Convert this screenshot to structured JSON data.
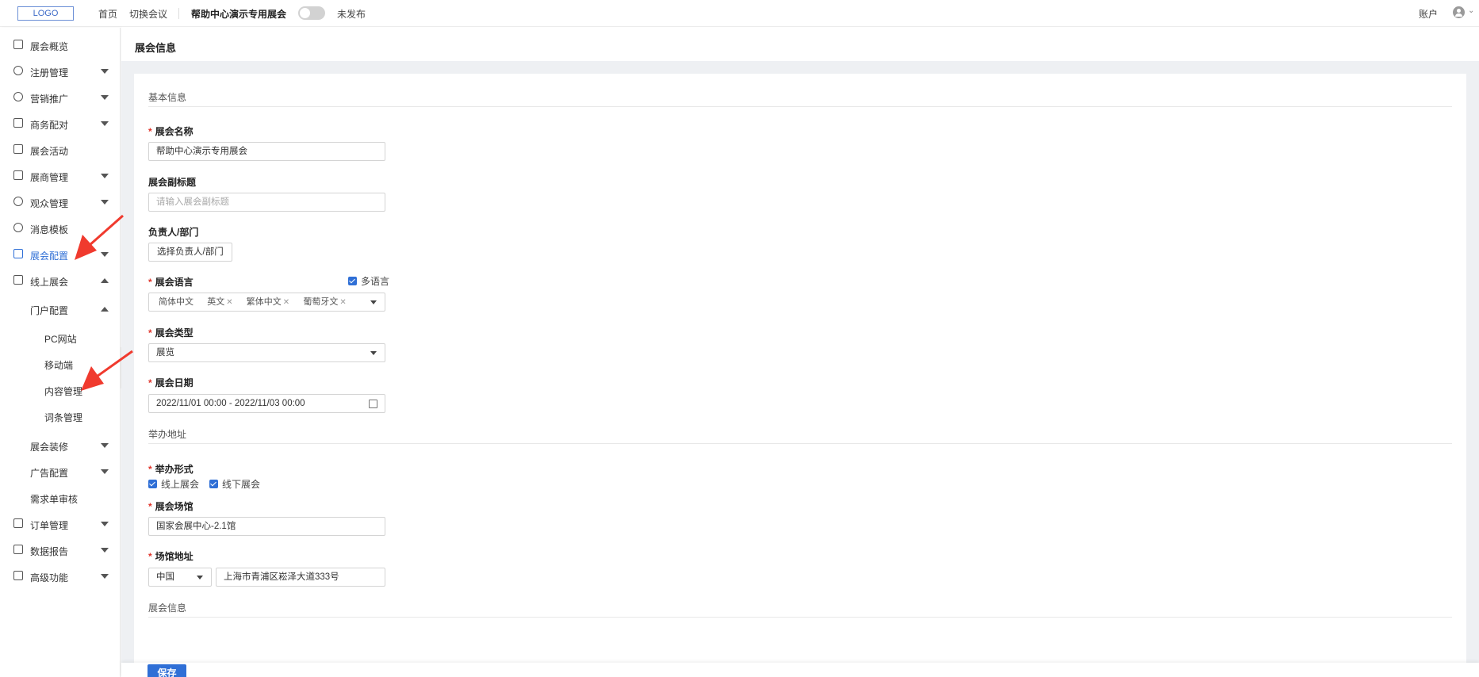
{
  "topbar": {
    "logo": "LOGO",
    "nav_home": "首页",
    "nav_switch": "切换会议",
    "event_name": "帮助中心演示专用展会",
    "status": "未发布",
    "account": "账户"
  },
  "sidebar": {
    "items": [
      {
        "label": "展会概览"
      },
      {
        "label": "注册管理"
      },
      {
        "label": "营销推广"
      },
      {
        "label": "商务配对"
      },
      {
        "label": "展会活动"
      },
      {
        "label": "展商管理"
      },
      {
        "label": "观众管理"
      },
      {
        "label": "消息模板"
      },
      {
        "label": "展会配置"
      },
      {
        "label": "线上展会"
      },
      {
        "label": "门户配置"
      },
      {
        "label": "PC网站"
      },
      {
        "label": "移动端"
      },
      {
        "label": "内容管理"
      },
      {
        "label": "词条管理"
      },
      {
        "label": "展会装修"
      },
      {
        "label": "广告配置"
      },
      {
        "label": "需求单审核"
      },
      {
        "label": "订单管理"
      },
      {
        "label": "数据报告"
      },
      {
        "label": "高级功能"
      }
    ]
  },
  "page": {
    "title": "展会信息",
    "section_basic": "基本信息",
    "name_label": "展会名称",
    "name_value": "帮助中心演示专用展会",
    "subtitle_label": "展会副标题",
    "subtitle_placeholder": "请输入展会副标题",
    "owner_label": "负责人/部门",
    "owner_button": "选择负责人/部门",
    "language_label": "展会语言",
    "multilang_label": "多语言",
    "languages": [
      "简体中文",
      "英文",
      "繁体中文",
      "葡萄牙文"
    ],
    "type_label": "展会类型",
    "type_value": "展览",
    "date_label": "展会日期",
    "date_value": "2022/11/01 00:00 - 2022/11/03 00:00",
    "section_address": "举办地址",
    "format_label": "举办形式",
    "format_online": "线上展会",
    "format_offline": "线下展会",
    "venue_label": "展会场馆",
    "venue_value": "国家会展中心-2.1馆",
    "address_label": "场馆地址",
    "country_value": "中国",
    "address_value": "上海市青浦区崧泽大道333号",
    "section_info": "展会信息",
    "save_label": "保存"
  },
  "colors": {
    "accent": "#2f6fd6",
    "required": "#e0342a",
    "annotation_arrow": "#f03a2e"
  }
}
